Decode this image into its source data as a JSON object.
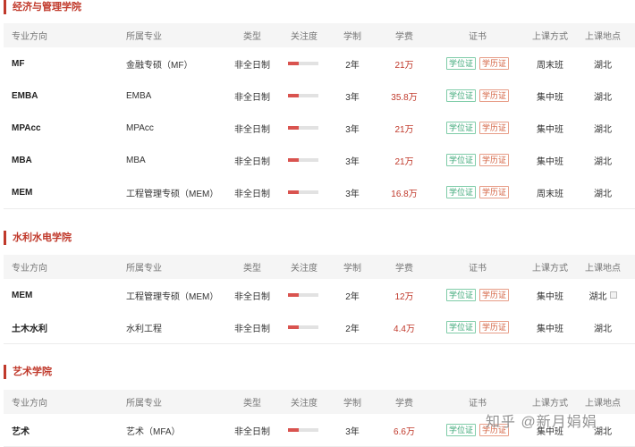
{
  "columns": [
    "专业方向",
    "所属专业",
    "类型",
    "关注度",
    "学制",
    "学费",
    "证书",
    "上课方式",
    "上课地点"
  ],
  "sections": [
    {
      "title": "经济与管理学院",
      "rows": [
        {
          "dir": "MF",
          "major": "金融专硕（MF）",
          "type": "非全日制",
          "attention": 0.35,
          "length": "2年",
          "fee": "21万",
          "certs": [
            "学位证",
            "学历证"
          ],
          "mode": "周末班",
          "location": "湖北"
        },
        {
          "dir": "EMBA",
          "major": "EMBA",
          "type": "非全日制",
          "attention": 0.35,
          "length": "3年",
          "fee": "35.8万",
          "certs": [
            "学位证",
            "学历证"
          ],
          "mode": "集中班",
          "location": "湖北"
        },
        {
          "dir": "MPAcc",
          "major": "MPAcc",
          "type": "非全日制",
          "attention": 0.35,
          "length": "3年",
          "fee": "21万",
          "certs": [
            "学位证",
            "学历证"
          ],
          "mode": "集中班",
          "location": "湖北"
        },
        {
          "dir": "MBA",
          "major": "MBA",
          "type": "非全日制",
          "attention": 0.35,
          "length": "3年",
          "fee": "21万",
          "certs": [
            "学位证",
            "学历证"
          ],
          "mode": "集中班",
          "location": "湖北"
        },
        {
          "dir": "MEM",
          "major": "工程管理专硕（MEM）",
          "type": "非全日制",
          "attention": 0.35,
          "length": "3年",
          "fee": "16.8万",
          "certs": [
            "学位证",
            "学历证"
          ],
          "mode": "周末班",
          "location": "湖北"
        }
      ]
    },
    {
      "title": "水利水电学院",
      "rows": [
        {
          "dir": "MEM",
          "major": "工程管理专硕（MEM）",
          "type": "非全日制",
          "attention": 0.35,
          "length": "2年",
          "fee": "12万",
          "certs": [
            "学位证",
            "学历证"
          ],
          "mode": "集中班",
          "location": "湖北"
        },
        {
          "dir": "土木水利",
          "major": "水利工程",
          "type": "非全日制",
          "attention": 0.35,
          "length": "2年",
          "fee": "4.4万",
          "certs": [
            "学位证",
            "学历证"
          ],
          "mode": "集中班",
          "location": "湖北"
        }
      ]
    },
    {
      "title": "艺术学院",
      "rows": [
        {
          "dir": "艺术",
          "major": "艺术（MFA）",
          "type": "非全日制",
          "attention": 0.35,
          "length": "3年",
          "fee": "6.6万",
          "certs": [
            "学位证",
            "学历证"
          ],
          "mode": "集中班",
          "location": "湖北"
        }
      ]
    }
  ],
  "watermark": "知乎 @新月娟娟",
  "colors": {
    "accent": "#c0392b",
    "bar": "#d9534f",
    "badge_green": "#3aa776",
    "badge_red": "#d35f3e"
  }
}
